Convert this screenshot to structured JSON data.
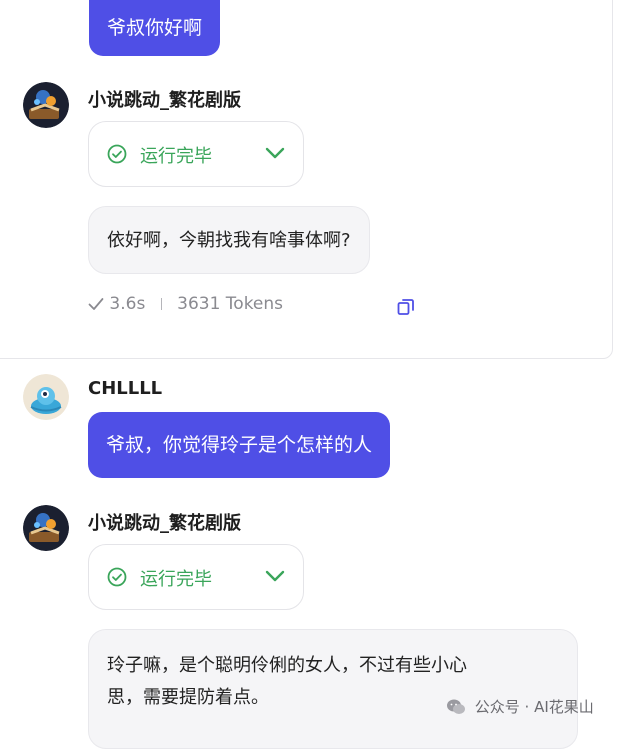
{
  "messages": {
    "user1": {
      "text": "爷叔你好啊"
    },
    "bot1": {
      "name": "小说跳动_繁花剧版",
      "status": "运行完毕",
      "reply": "依好啊，今朝找我有啥事体啊?",
      "time": "3.6s",
      "tokens": "3631 Tokens"
    },
    "user2": {
      "name": "CHLLLL",
      "text": "爷叔，你觉得玲子是个怎样的人"
    },
    "bot2": {
      "name": "小说跳动_繁花剧版",
      "status": "运行完毕",
      "reply_line1": "玲子嘛，是个聪明伶俐的女人，不过有些小心",
      "reply_line2": "思，需要提防着点。"
    }
  },
  "watermark": "公众号 · AI花果山",
  "colors": {
    "accent": "#4f4fe6",
    "success": "#3aa55a"
  }
}
